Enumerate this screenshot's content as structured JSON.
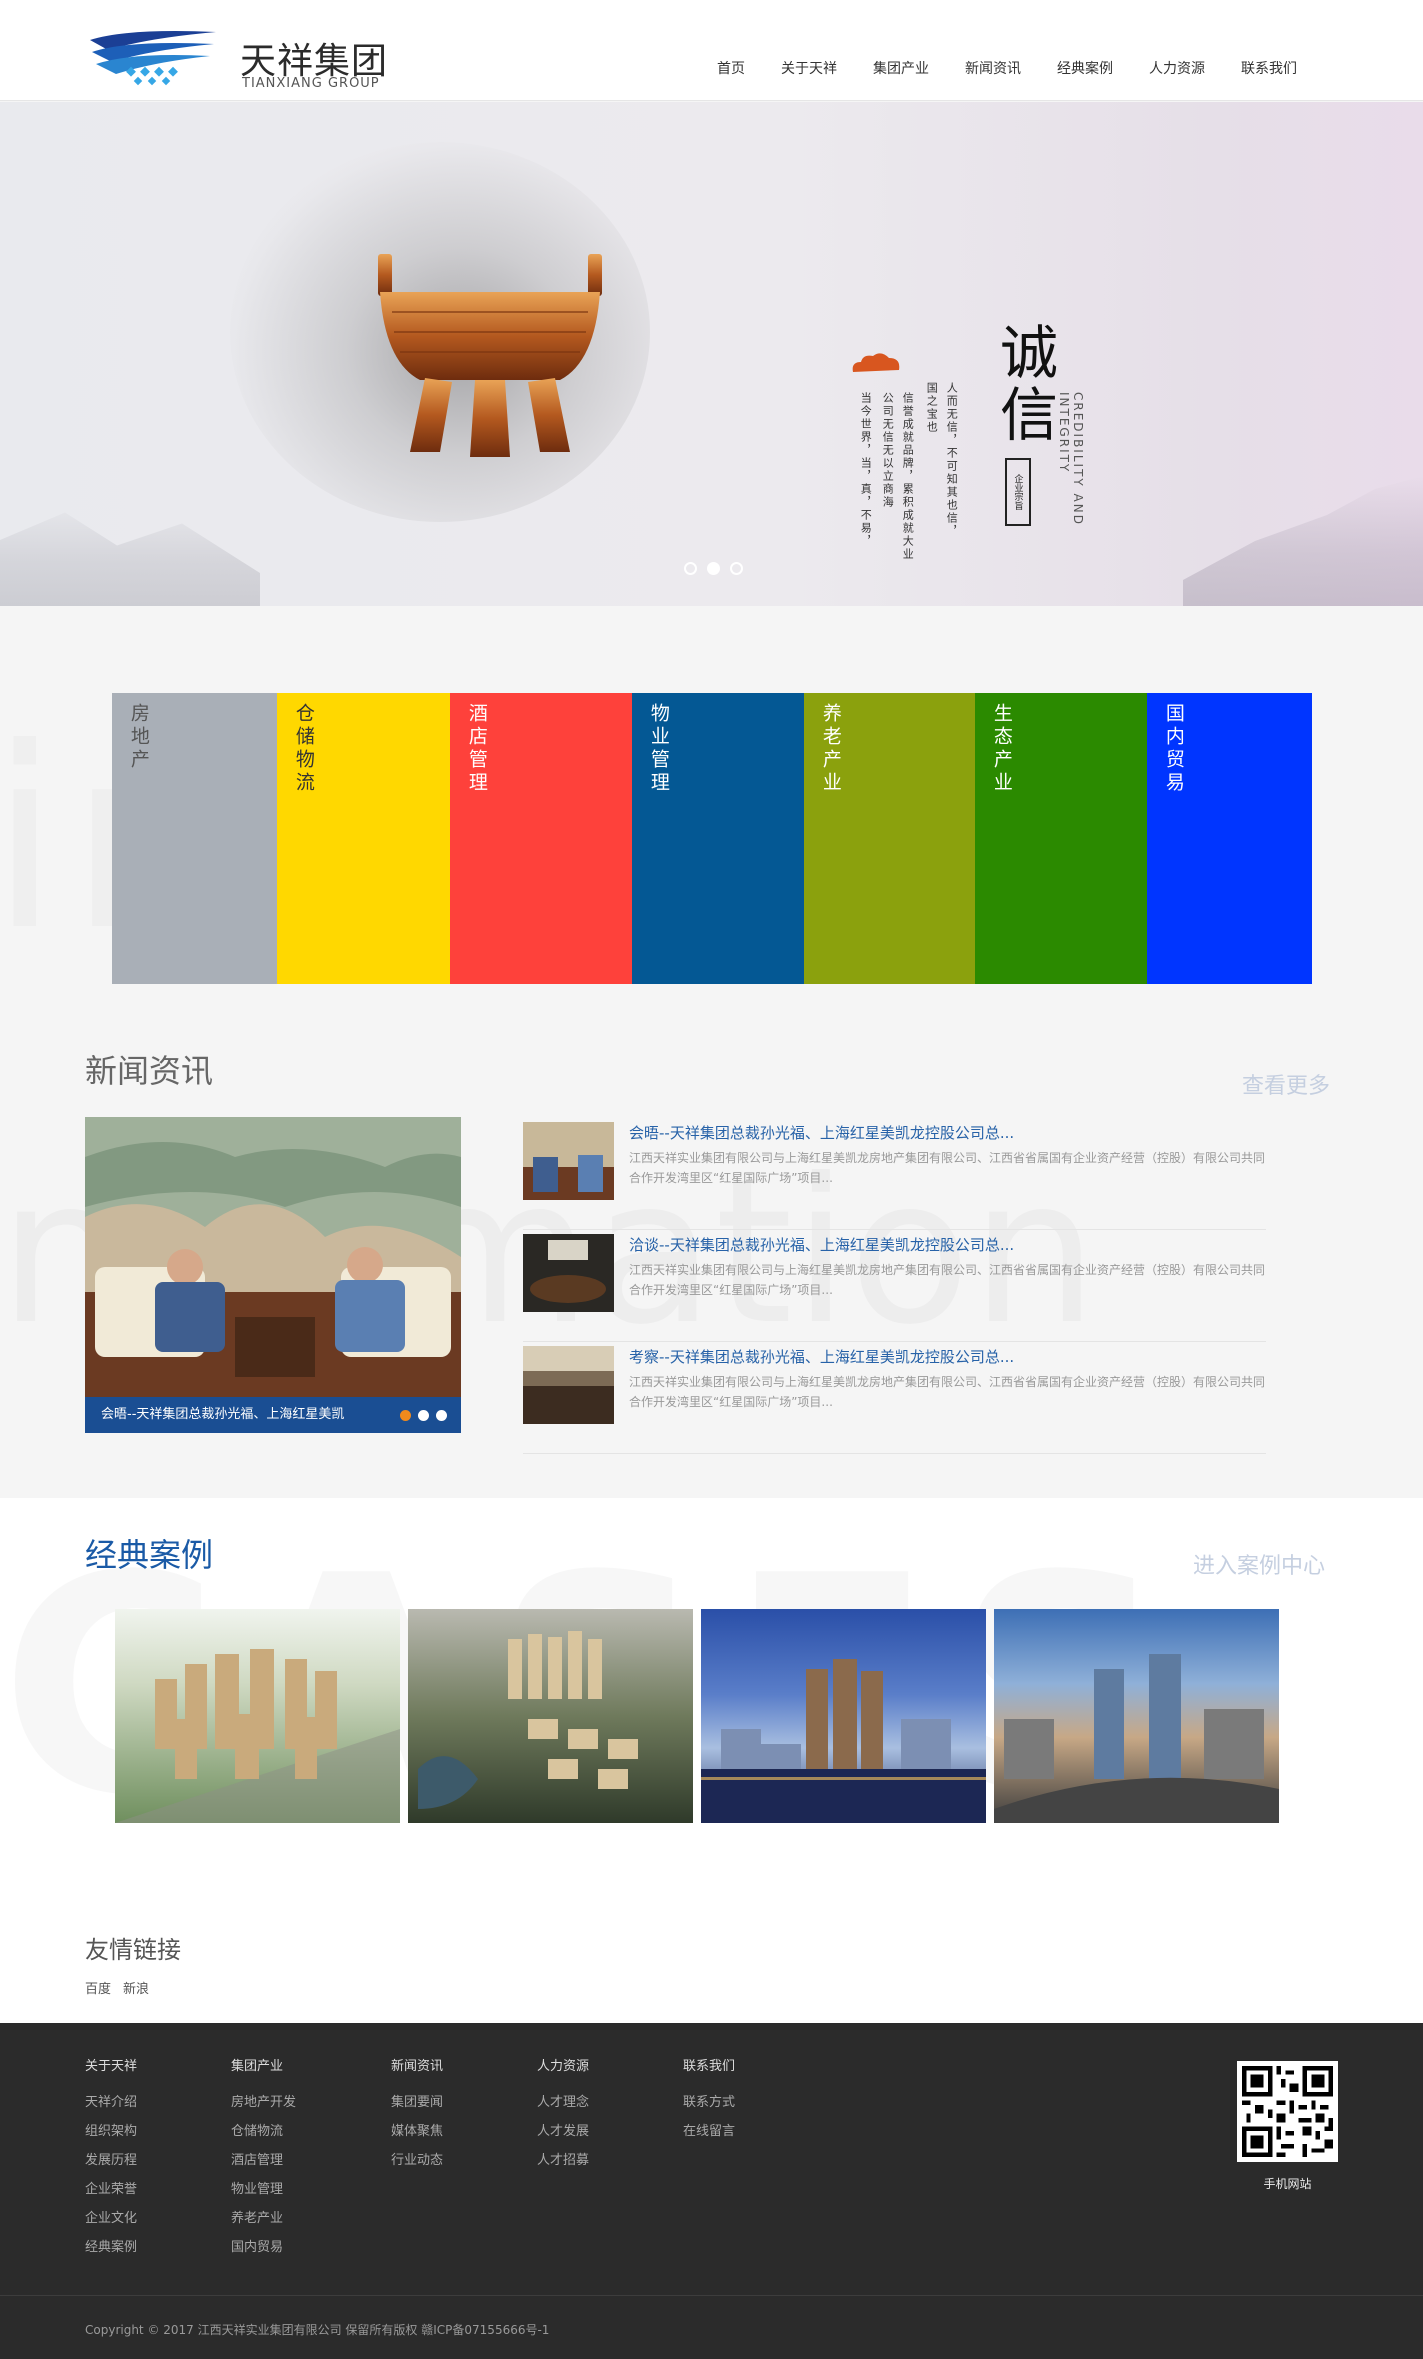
{
  "brand": {
    "name_cn": "天祥集团",
    "name_en": "TIANXIANG GROUP",
    "primary_color": "#1a4e93"
  },
  "nav": [
    {
      "label": "首页"
    },
    {
      "label": "关于天祥"
    },
    {
      "label": "集团产业"
    },
    {
      "label": "新闻资讯"
    },
    {
      "label": "经典案例"
    },
    {
      "label": "人力资源"
    },
    {
      "label": "联系我们"
    }
  ],
  "banner": {
    "title": "诚信",
    "subtitle_en": "CREDIBILITY AND INTEGRITY",
    "seal_text": "企业宗旨",
    "text_columns": [
      "人而无信，不可知其也信，",
      "国之宝也",
      "信誉成就品牌，累积成就大业",
      "公司无信无以立商海",
      "当今世界，当，真，不易，"
    ],
    "slide_count": 3,
    "active_slide": 2
  },
  "industries": [
    {
      "label": "房地产",
      "color": "#a9afb7",
      "text_color": "#555555"
    },
    {
      "label": "仓储物流",
      "color": "#ffd800",
      "text_color": "#333333"
    },
    {
      "label": "酒店管理",
      "color": "#fe413b",
      "text_color": "#ffffff"
    },
    {
      "label": "物业管理",
      "color": "#045894",
      "text_color": "#ffffff"
    },
    {
      "label": "养老产业",
      "color": "#8ba10d",
      "text_color": "#ffffff"
    },
    {
      "label": "生态产业",
      "color": "#2b8a00",
      "text_color": "#ffffff"
    },
    {
      "label": "国内贸易",
      "color": "#0035ff",
      "text_color": "#ffffff"
    }
  ],
  "news": {
    "title": "新闻资讯",
    "more": "查看更多",
    "featured_caption": "会晤--天祥集团总裁孙光福、上海红星美凯",
    "featured_slides": 3,
    "featured_active": 1,
    "items": [
      {
        "title": "会晤--天祥集团总裁孙光福、上海红星美凯龙控股公司总...",
        "desc": "江西天祥实业集团有限公司与上海红星美凯龙房地产集团有限公司、江西省省属国有企业资产经营（控股）有限公司共同合作开发湾里区“红星国际广场”项目..."
      },
      {
        "title": "洽谈--天祥集团总裁孙光福、上海红星美凯龙控股公司总...",
        "desc": "江西天祥实业集团有限公司与上海红星美凯龙房地产集团有限公司、江西省省属国有企业资产经营（控股）有限公司共同合作开发湾里区“红星国际广场”项目..."
      },
      {
        "title": "考察--天祥集团总裁孙光福、上海红星美凯龙控股公司总...",
        "desc": "江西天祥实业集团有限公司与上海红星美凯龙房地产集团有限公司、江西省省属国有企业资产经营（控股）有限公司共同合作开发湾里区“红星国际广场”项目..."
      }
    ]
  },
  "cases": {
    "title": "经典案例",
    "more": "进入案例中心",
    "watermark": "CASES"
  },
  "friends": {
    "title": "友情链接",
    "links": [
      "百度",
      "新浪"
    ]
  },
  "footer": {
    "columns": [
      {
        "head": "关于天祥",
        "items": [
          "天祥介绍",
          "组织架构",
          "发展历程",
          "企业荣誉",
          "企业文化",
          "经典案例"
        ]
      },
      {
        "head": "集团产业",
        "items": [
          "房地产开发",
          "仓储物流",
          "酒店管理",
          "物业管理",
          "养老产业",
          "国内贸易"
        ]
      },
      {
        "head": "新闻资讯",
        "items": [
          "集团要闻",
          "媒体聚焦",
          "行业动态"
        ]
      },
      {
        "head": "人力资源",
        "items": [
          "人才理念",
          "人才发展",
          "人才招募"
        ]
      },
      {
        "head": "联系我们",
        "items": [
          "联系方式",
          "在线留言"
        ]
      }
    ],
    "qr_label": "手机网站",
    "copyright": "Copyright © 2017 江西天祥实业集团有限公司 保留所有版权 赣ICP备07155666号-1"
  }
}
